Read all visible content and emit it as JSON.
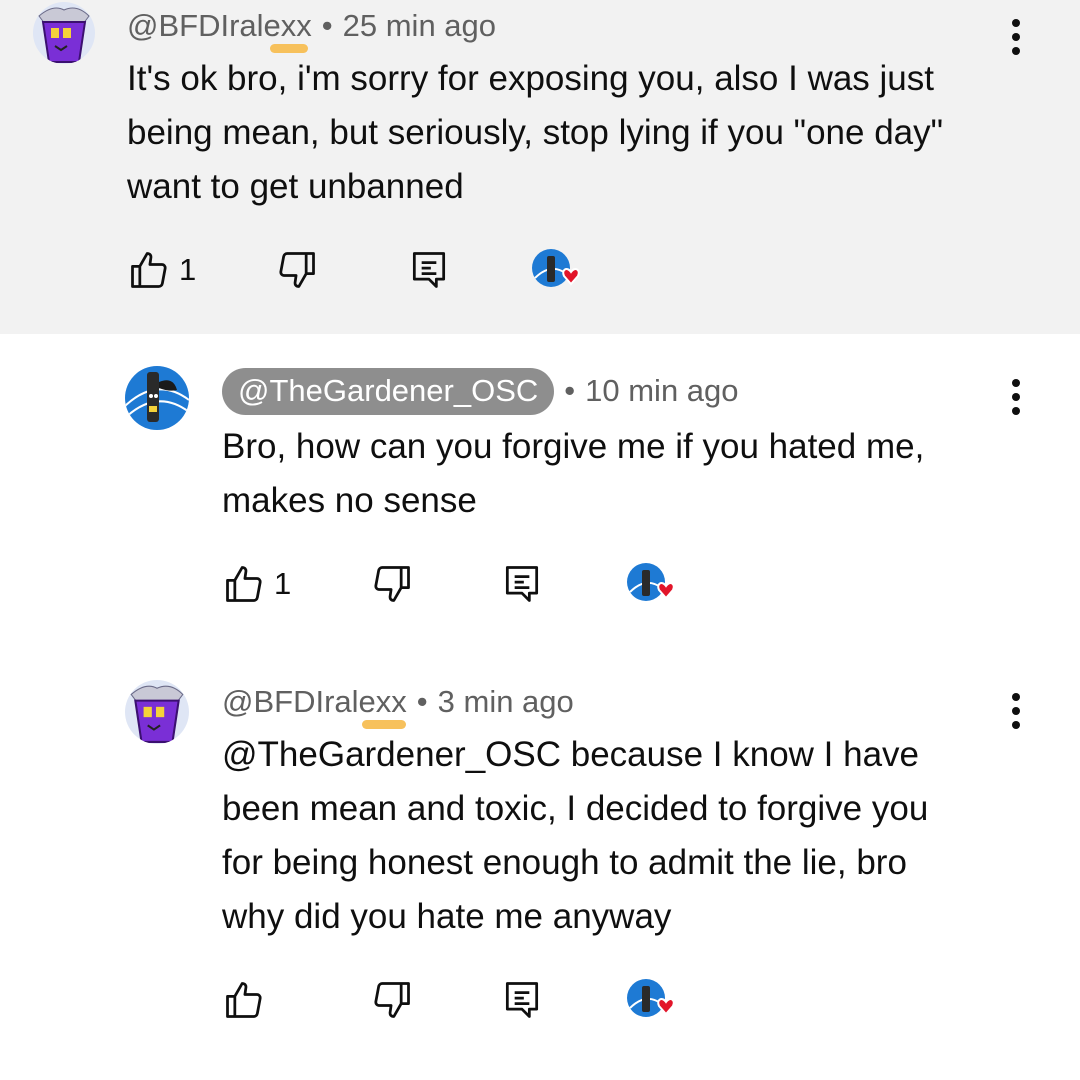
{
  "comments": [
    {
      "author": "@BFDIralexx",
      "separator": "•",
      "time": "25 min ago",
      "text_lines": [
        "It's ok bro, i'm sorry for exposing you, also I was just",
        "being mean, but seriously, stop lying if you \"one day\"",
        "want to get unbanned"
      ],
      "likes": "1",
      "avatar_icon": "purple-bucket-avatar-icon"
    },
    {
      "author": "@TheGardener_OSC",
      "separator": "•",
      "time": "10 min ago",
      "text_lines": [
        "Bro, how can you forgive me if you hated me,",
        "makes no sense"
      ],
      "likes": "1",
      "avatar_icon": "blue-character-avatar-icon"
    },
    {
      "author": "@BFDIralexx",
      "separator": "•",
      "time": "3 min ago",
      "mention": "@TheGardener_OSC",
      "text_lines": [
        " because I know I have",
        "been mean and toxic, I decided to forgive you",
        "for being honest enough to admit the lie, bro",
        "why did you hate me anyway"
      ],
      "likes": "",
      "avatar_icon": "purple-bucket-avatar-icon"
    }
  ],
  "icons": {
    "like": "thumb-up-icon",
    "dislike": "thumb-down-icon",
    "reply": "reply-icon",
    "creator_heart": "creator-heart-icon",
    "more": "more-vertical-icon"
  },
  "colors": {
    "highlight_bg": "#f2f2f2",
    "pill_bg": "#8e8e8e",
    "heart": "#e2152a",
    "marker": "#f7c15c"
  }
}
